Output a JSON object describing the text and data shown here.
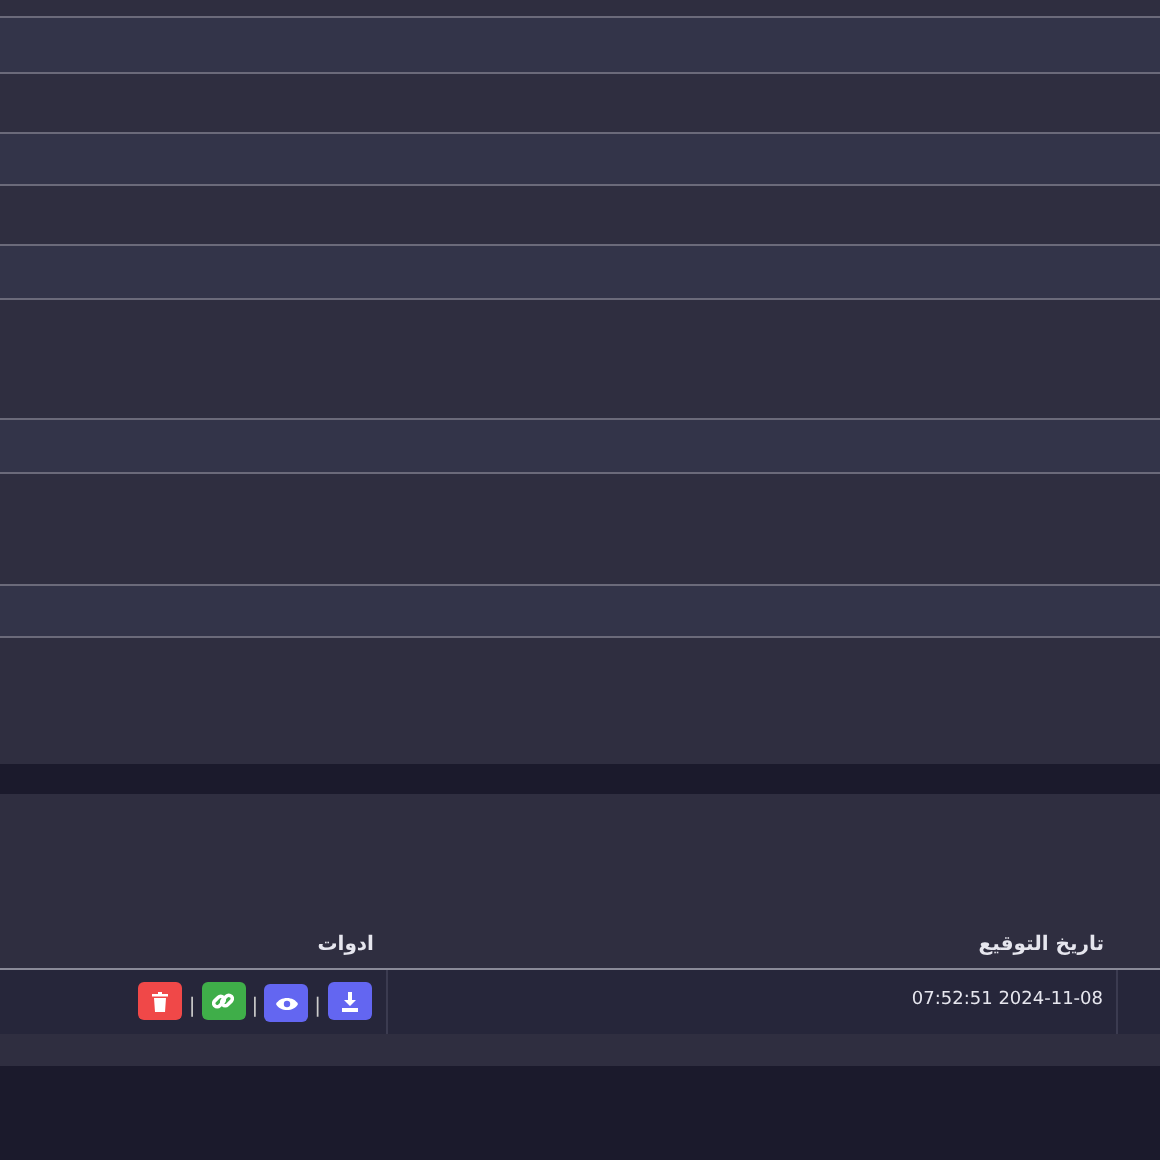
{
  "table": {
    "columns": [
      {
        "label": "تاريخ التوقيع"
      },
      {
        "label": "ادوات"
      }
    ],
    "rows": [
      {
        "date": "07:52:51 2024-11-08",
        "tools": [
          {
            "kind": "download"
          },
          {
            "kind": "view"
          },
          {
            "kind": "link"
          },
          {
            "kind": "delete"
          }
        ],
        "separator": "|"
      }
    ]
  }
}
